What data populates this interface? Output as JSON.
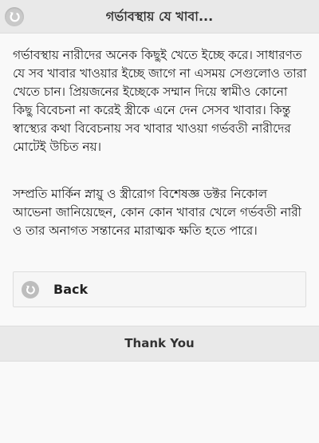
{
  "header": {
    "title": "গর্ভাবস্থায় যে খাবা...",
    "back_icon": "back-arrow-icon"
  },
  "article": {
    "paragraphs": [
      "গর্ভাবস্থায় নারীদের অনেক কিছুই খেতে ইচ্ছে করে। সাধারণত যে সব খাবার খাওয়ার ইচ্ছে জাগে না এসময় সেগুলোও তারা খেতে চান। প্রিয়জনের ইচ্ছেকে সম্মান দিয়ে স্বামীও কোনো কিছু বিবেচনা না করেই স্ত্রীকে এনে দেন সেসব খাবার। কিন্তু স্বাস্থ্যের কথা বিবেচনায় সব খাবার খাওয়া গর্ভবতী নারীদের মোটেই উচিত নয়।",
      "সম্প্রতি মার্কিন স্নায়ু ও স্ত্রীরোগ বিশেষজ্ঞ ডক্টর নিকোল আভেনা জানিয়েছেন, কোন কোন খাবার খেলে গর্ভবতী নারী ও তার অনাগত সন্তানের মারাত্মক ক্ষতি হতে পারে।"
    ]
  },
  "back_button": {
    "label": "Back",
    "icon": "back-arrow-icon"
  },
  "footer": {
    "text": "Thank You"
  }
}
